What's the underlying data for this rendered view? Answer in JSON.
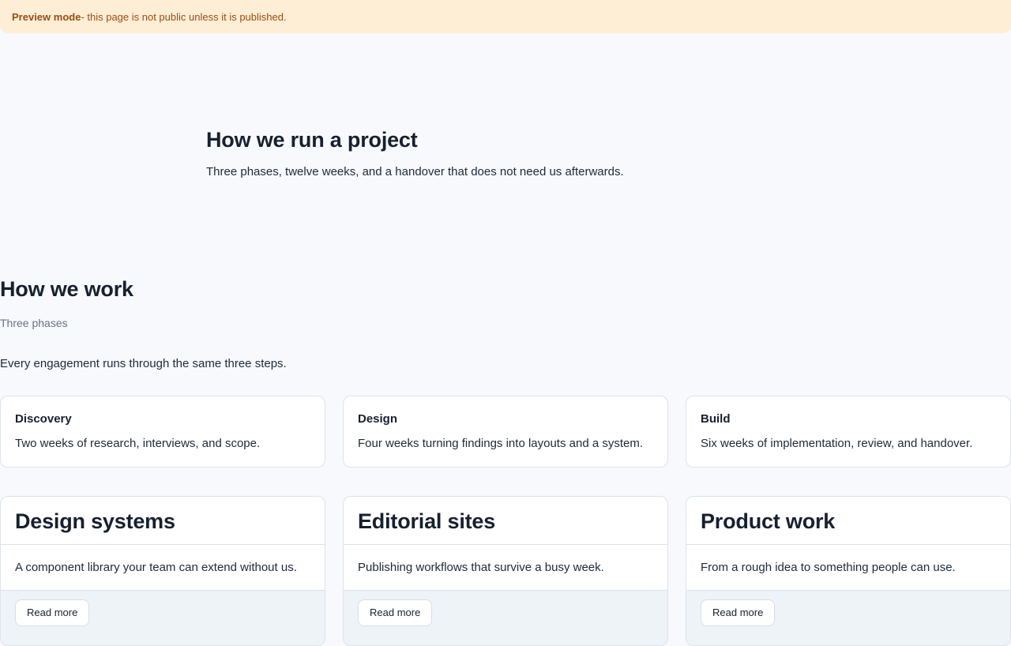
{
  "banner": {
    "label": "Preview mode",
    "message": " - this page is not public unless it is published."
  },
  "hero": {
    "title": "How we run a project",
    "subtitle": "Three phases, twelve weeks, and a handover that does not need us afterwards."
  },
  "section": {
    "title": "How we work",
    "kicker": "Three phases",
    "lead": "Every engagement runs through the same three steps."
  },
  "phases": [
    {
      "title": "Discovery",
      "description": "Two weeks of research, interviews, and scope."
    },
    {
      "title": "Design",
      "description": "Four weeks turning findings into layouts and a system."
    },
    {
      "title": "Build",
      "description": "Six weeks of implementation, review, and handover."
    }
  ],
  "services": [
    {
      "title": "Design systems",
      "description": "A component library your team can extend without us.",
      "button_label": "Read more"
    },
    {
      "title": "Editorial sites",
      "description": "Publishing workflows that survive a busy week.",
      "button_label": "Read more"
    },
    {
      "title": "Product work",
      "description": "From a rough idea to something people can use.",
      "button_label": "Read more"
    }
  ],
  "colors": {
    "banner_background": "#feeed5",
    "banner_text": "#9a4d12",
    "page_background": "#f7f9fc",
    "heading": "#17202f"
  }
}
